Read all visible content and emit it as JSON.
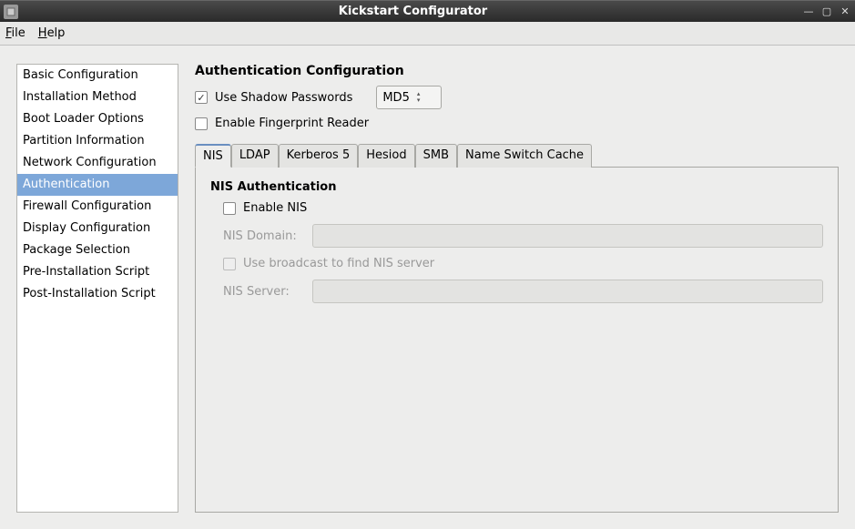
{
  "window": {
    "title": "Kickstart Configurator"
  },
  "menubar": {
    "file": "File",
    "help": "Help"
  },
  "sidebar": {
    "items": [
      "Basic Configuration",
      "Installation Method",
      "Boot Loader Options",
      "Partition Information",
      "Network Configuration",
      "Authentication",
      "Firewall Configuration",
      "Display Configuration",
      "Package Selection",
      "Pre-Installation Script",
      "Post-Installation Script"
    ],
    "selected_index": 5
  },
  "main": {
    "heading": "Authentication Configuration",
    "use_shadow": {
      "label": "Use Shadow Passwords",
      "checked": true
    },
    "hash_algo": {
      "value": "MD5"
    },
    "enable_fpr": {
      "label": "Enable Fingerprint Reader",
      "checked": false
    },
    "tabs": [
      "NIS",
      "LDAP",
      "Kerberos 5",
      "Hesiod",
      "SMB",
      "Name Switch Cache"
    ],
    "active_tab": 0,
    "nis": {
      "heading": "NIS Authentication",
      "enable": {
        "label": "Enable NIS",
        "checked": false
      },
      "domain_label": "NIS Domain:",
      "domain_value": "",
      "broadcast": {
        "label": "Use broadcast to find NIS server",
        "checked": false
      },
      "server_label": "NIS Server:",
      "server_value": ""
    }
  }
}
